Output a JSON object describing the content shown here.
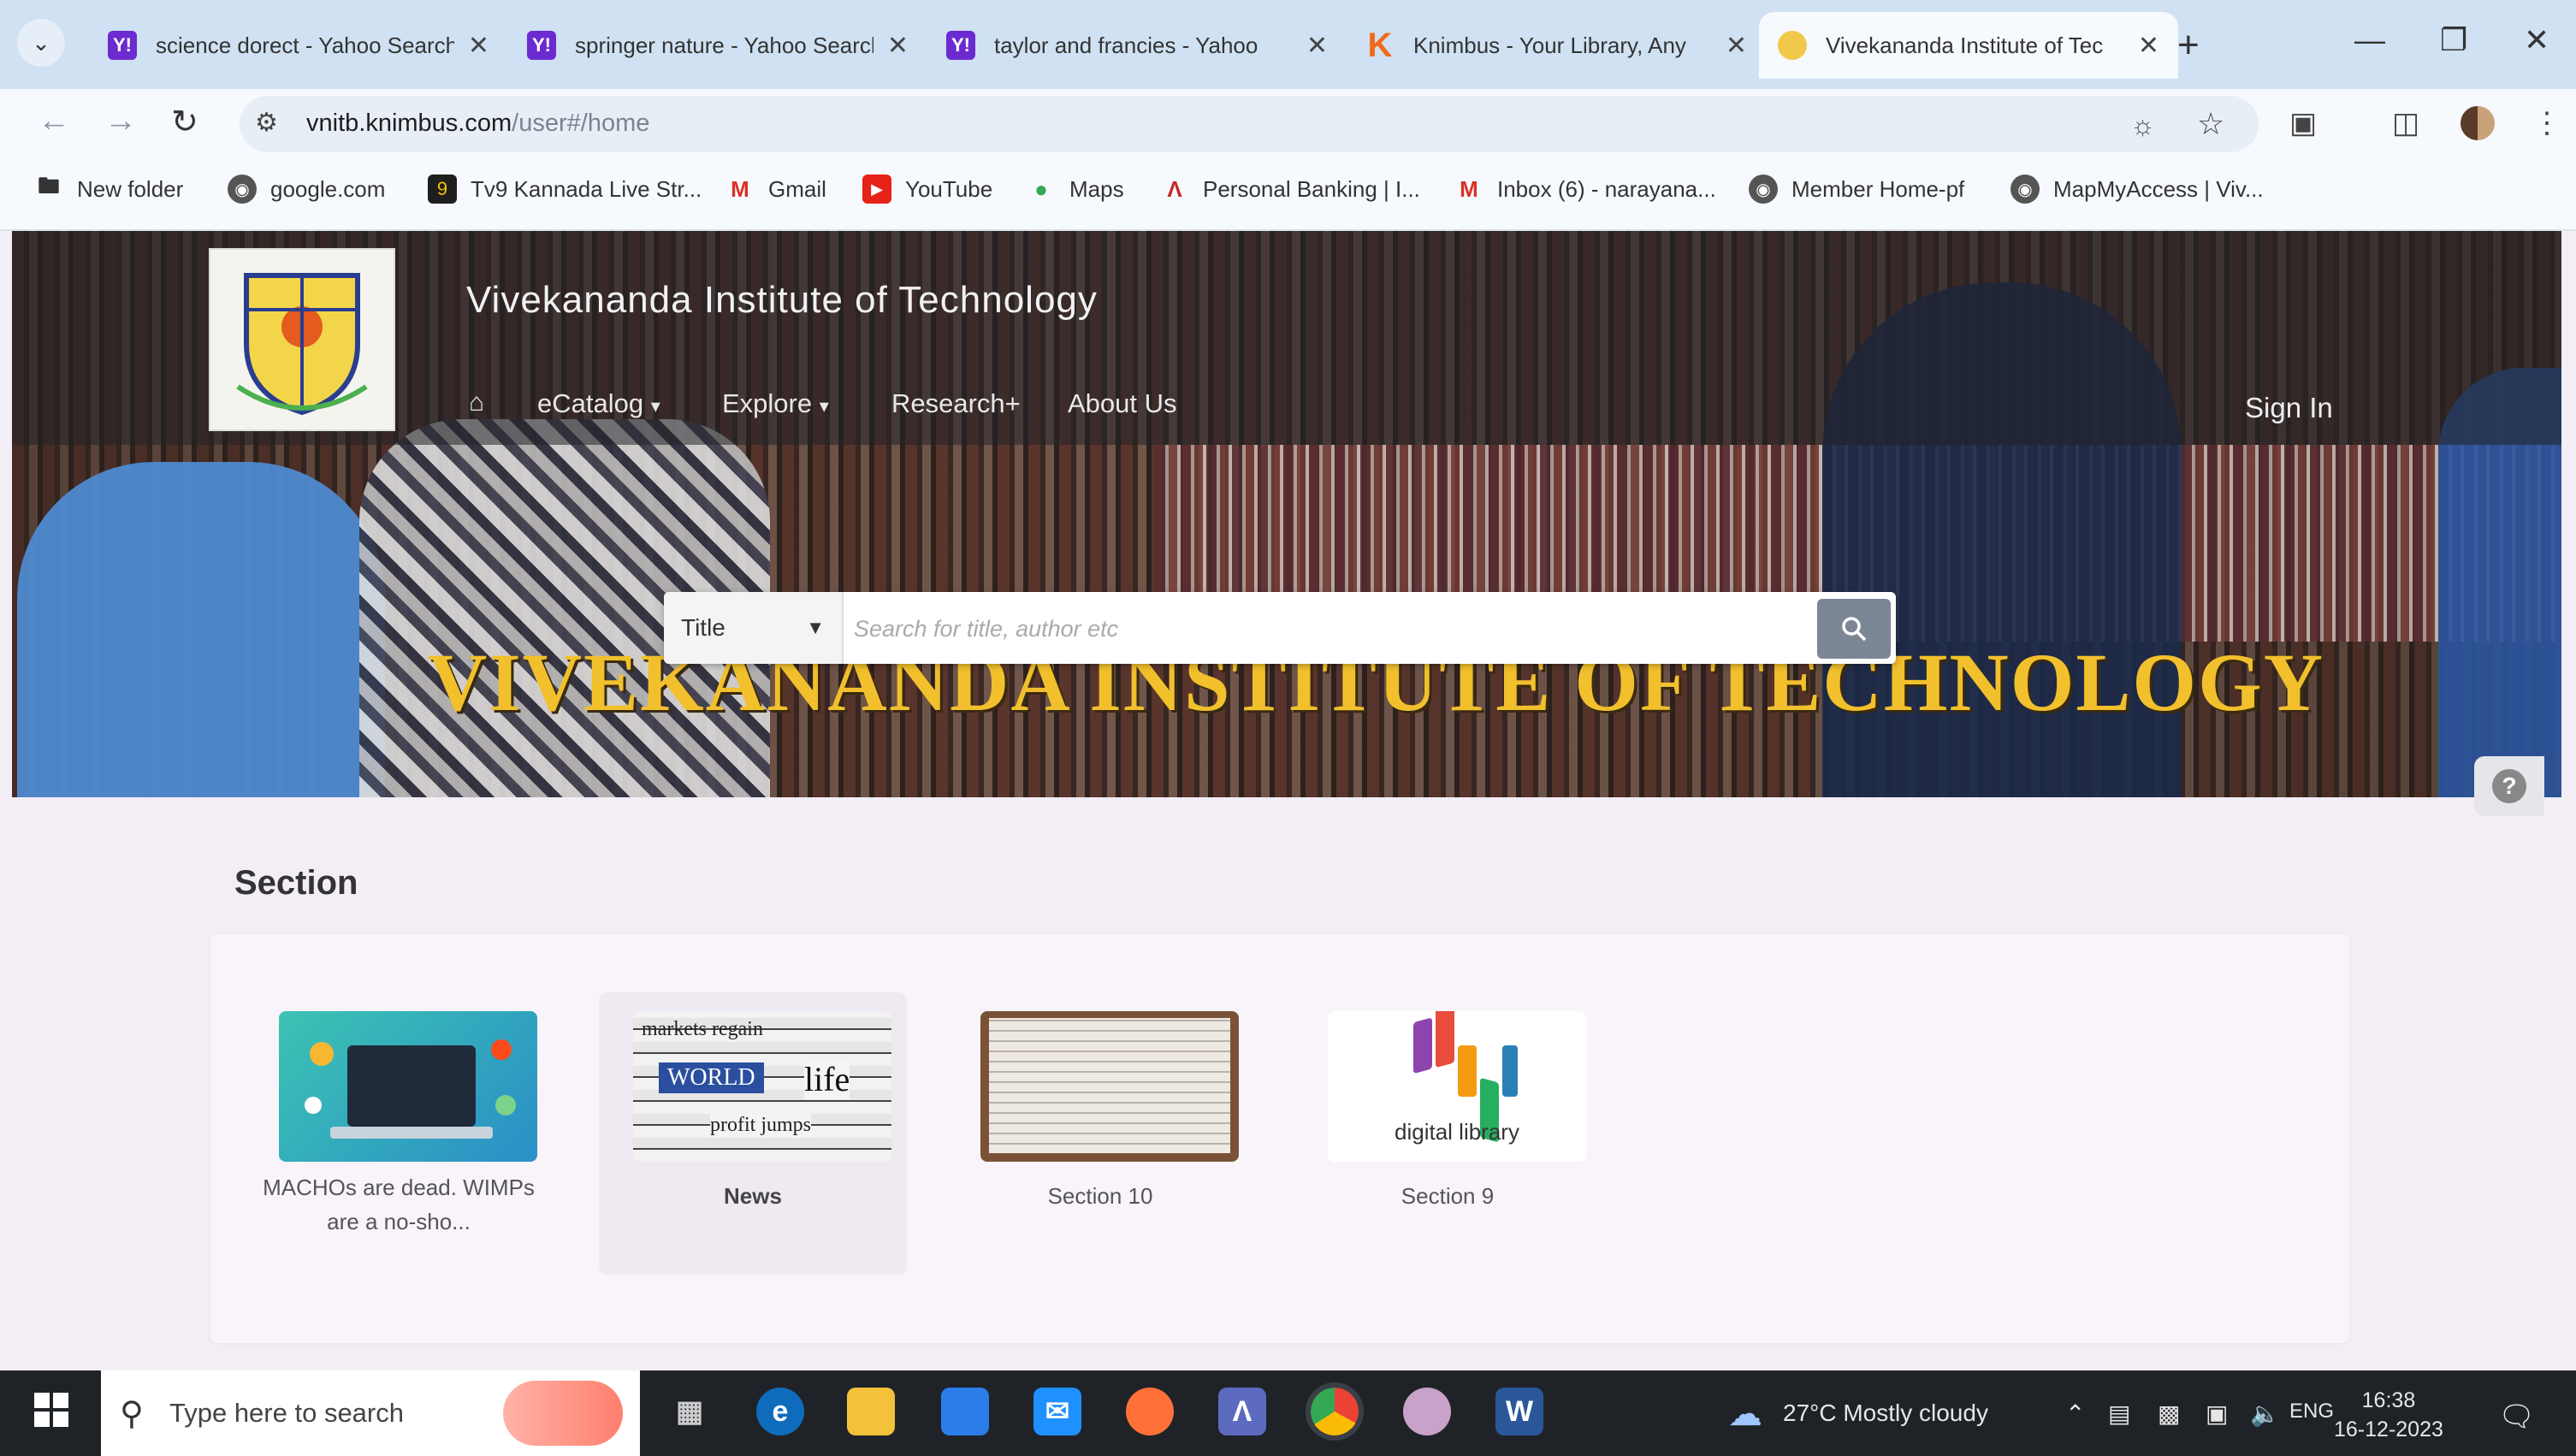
{
  "browser": {
    "tabs": [
      {
        "title": "science dorect - Yahoo Search",
        "favicon": "yahoo-icon",
        "active": false
      },
      {
        "title": "springer nature - Yahoo Search",
        "favicon": "yahoo-icon",
        "active": false
      },
      {
        "title": "taylor and francies - Yahoo",
        "favicon": "yahoo-icon",
        "active": false
      },
      {
        "title": "Knimbus - Your Library, Any",
        "favicon": "knimbus-icon",
        "active": false
      },
      {
        "title": "Vivekananda Institute of Tec",
        "favicon": "vit-icon",
        "active": true
      }
    ],
    "tab_close_glyph": "✕",
    "favicon_letters": {
      "yahoo": "Y!",
      "knimbus": "K"
    },
    "new_tab_glyph": "+",
    "url_host": "vnitb.knimbus.com",
    "url_path": "/user#/home",
    "bookmarks": [
      {
        "label": "New folder",
        "icon": "folder-icon"
      },
      {
        "label": "google.com",
        "icon": "globe-icon"
      },
      {
        "label": "Tv9 Kannada Live Str...",
        "icon": "tv9-icon"
      },
      {
        "label": "Gmail",
        "icon": "gmail-icon"
      },
      {
        "label": "YouTube",
        "icon": "youtube-icon"
      },
      {
        "label": "Maps",
        "icon": "maps-icon"
      },
      {
        "label": "Personal Banking | I...",
        "icon": "bank-icon"
      },
      {
        "label": "Inbox (6) - narayana...",
        "icon": "gmail-icon"
      },
      {
        "label": "Member Home-pf",
        "icon": "globe-icon"
      },
      {
        "label": "MapMyAccess | Viv...",
        "icon": "globe-icon"
      }
    ]
  },
  "site": {
    "title": "Vivekananda Institute of Technology",
    "menu": [
      {
        "label": "eCatalog",
        "dropdown": true
      },
      {
        "label": "Explore",
        "dropdown": true
      },
      {
        "label": "Research+",
        "dropdown": false
      },
      {
        "label": "About Us",
        "dropdown": false
      }
    ],
    "sign_in": "Sign In",
    "banner_text": "VIVEKANANDA INSTITUTE OF TECHNOLOGY",
    "search": {
      "selected_field": "Title",
      "placeholder": "Search for title, author etc"
    },
    "help_glyph": "?",
    "section_heading": "Section",
    "cards": [
      {
        "label": "MACHOs are dead. WIMPs are a no-sho...",
        "bold": false
      },
      {
        "label": "News",
        "bold": true
      },
      {
        "label": "Section 10",
        "bold": false
      },
      {
        "label": "Section 9",
        "bold": false
      }
    ],
    "news_thumb_words": [
      "markets regain",
      "WORLD",
      "life",
      "profit jumps"
    ],
    "digital_library_text": "digital library"
  },
  "taskbar": {
    "search_placeholder": "Type here to search",
    "word_letter": "W",
    "weather": "27°C  Mostly cloudy",
    "language": "ENG",
    "time": "16:38",
    "date": "16-12-2023"
  },
  "colors": {
    "tabbar": "#cfe1f2",
    "banner_gold": "#f1c02c",
    "page_bg": "#f3eef6"
  }
}
